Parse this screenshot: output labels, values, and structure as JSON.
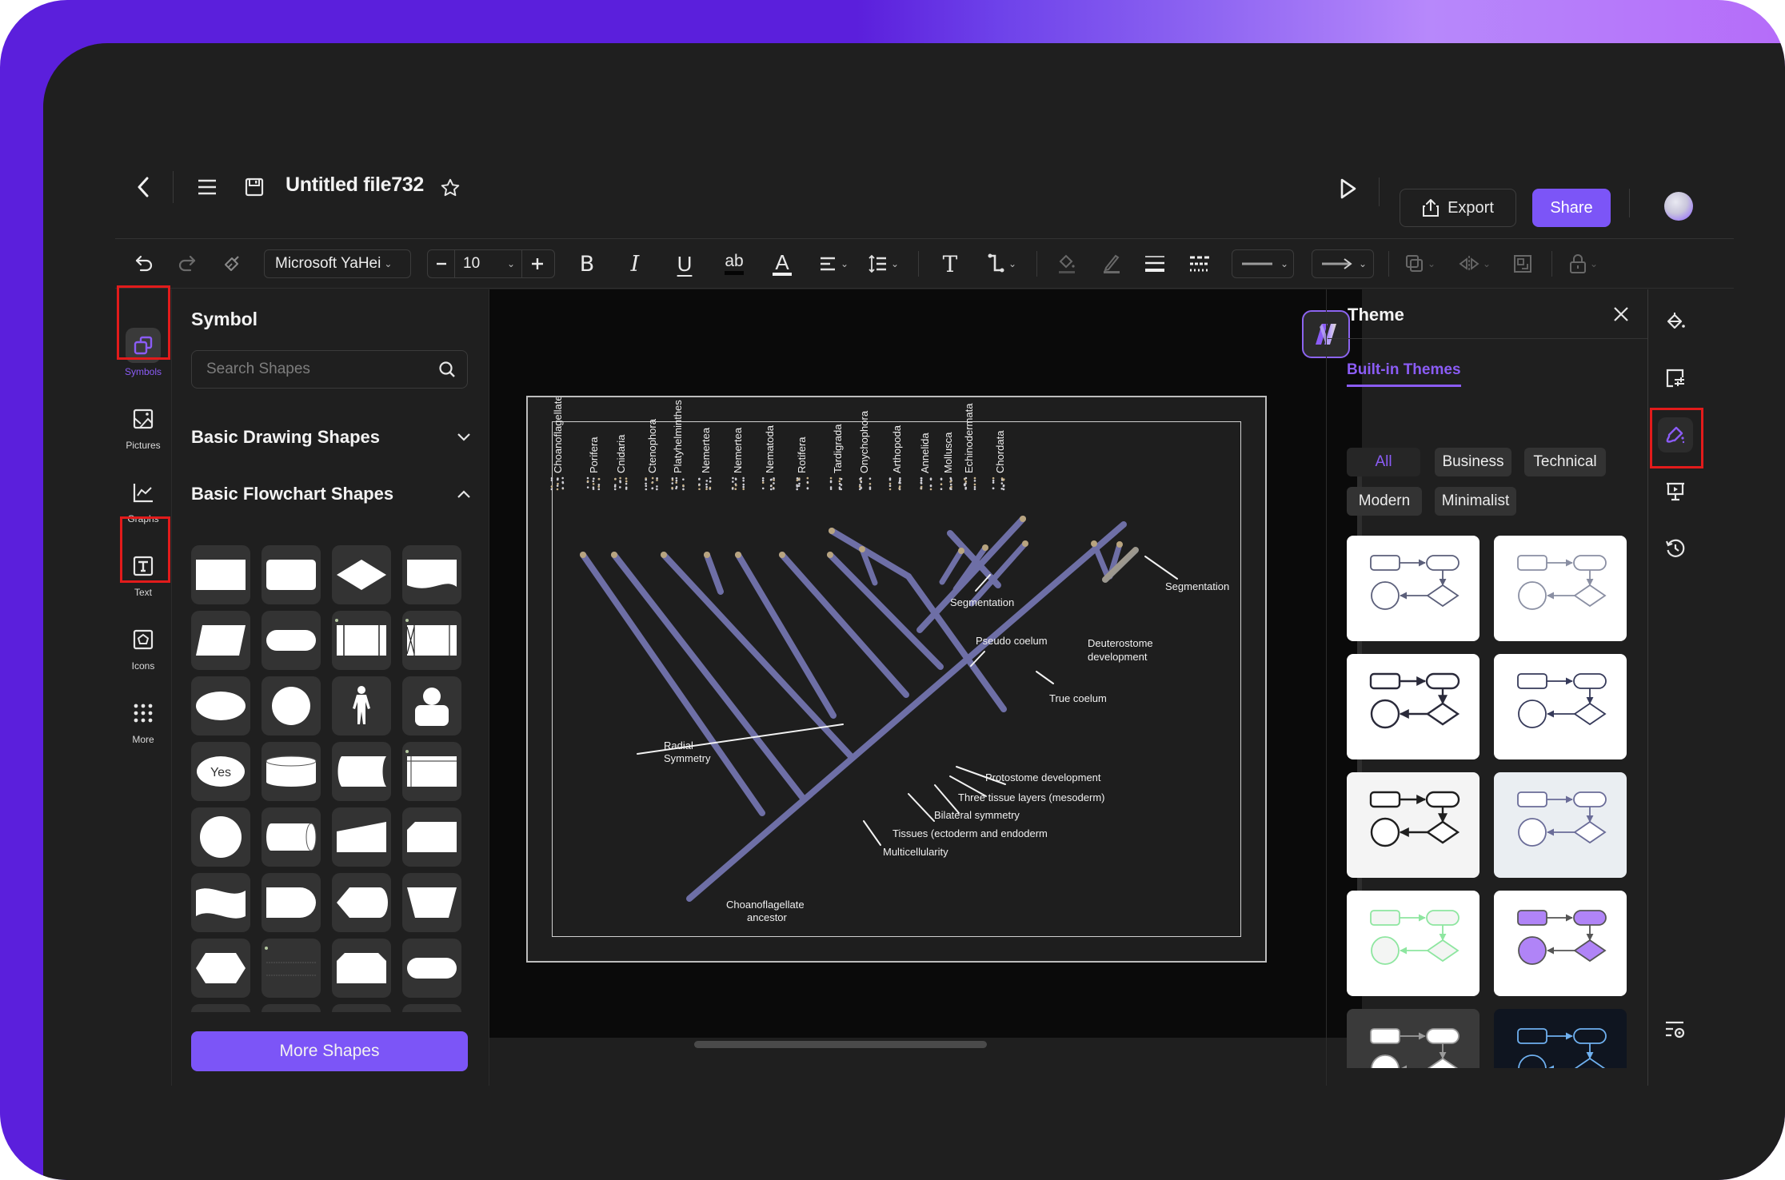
{
  "header": {
    "back_icon": "chevron-left-icon",
    "menu_icon": "hamburger-menu-icon",
    "save_icon": "floppy-save-icon",
    "file_title": "Untitled file732",
    "favorite_icon": "star-icon",
    "play_icon": "play-icon",
    "export_label": "Export",
    "export_icon": "export-share-icon",
    "share_label": "Share",
    "avatar": "user-avatar"
  },
  "toolbar": {
    "undo": "undo-icon",
    "redo": "redo-icon",
    "format_painter": "format-painter-icon",
    "font_family": "Microsoft YaHei",
    "font_size": "10",
    "decrease": "minus-icon",
    "increase": "plus-icon",
    "bold": "B",
    "italic": "I",
    "underline": "U",
    "text_highlight": "ab",
    "font_color": "A",
    "align": "align-icon",
    "line_spacing": "line-spacing-icon",
    "text_tool": "T",
    "connector": "connector-icon",
    "fill": "fill-bucket-icon",
    "line_color": "pen-icon",
    "line_weight": "line-weight-icon",
    "dash_style": "dash-style-icon",
    "line_style_select": "line-style",
    "arrow_style_select": "arrow-style",
    "arrange": "arrange-icon",
    "flip": "flip-icon",
    "group": "group-icon",
    "lock": "lock-icon"
  },
  "left_rail": {
    "items": [
      {
        "label": "Symbols",
        "icon": "symbols-icon",
        "active": true
      },
      {
        "label": "Pictures",
        "icon": "picture-icon",
        "active": false
      },
      {
        "label": "Graphs",
        "icon": "graph-icon",
        "active": false
      },
      {
        "label": "Text",
        "icon": "text-box-icon",
        "active": false
      },
      {
        "label": "Icons",
        "icon": "icons-icon",
        "active": false
      },
      {
        "label": "More",
        "icon": "grid-dots-icon",
        "active": false
      }
    ]
  },
  "symbol_panel": {
    "title": "Symbol",
    "search_placeholder": "Search Shapes",
    "sections": [
      {
        "title": "Basic Drawing Shapes",
        "expanded": false
      },
      {
        "title": "Basic Flowchart Shapes",
        "expanded": true
      }
    ],
    "shapes": [
      "process",
      "rounded-rectangle",
      "decision",
      "document",
      "data-parallelogram",
      "terminator",
      "predefined-process",
      "stored-data-frame",
      "ellipse",
      "circle",
      "actor",
      "user",
      "yes-decision",
      "database-cylinder",
      "stored-data",
      "internal-storage",
      "connector-circle",
      "direct-access-storage",
      "manual-input",
      "card",
      "punched-tape",
      "delay",
      "display",
      "manual-operation",
      "preparation-hexagon",
      "note-lines",
      "loop-limit",
      "terminator-rounded"
    ],
    "yes_text": "Yes",
    "more_shapes_label": "More Shapes"
  },
  "canvas": {
    "ai_badge": "ai-assistant-icon",
    "diagram": {
      "taxa": [
        "Choanoflagellate s",
        "Porifera",
        "Cnidaria",
        "Ctenophora",
        "Platyhelminthes",
        "Nemertea",
        "Nemertea",
        "Nematoda",
        "Rotifera",
        "Tardigrada",
        "Onychophora",
        "Arthopoda",
        "Annelida",
        "Mollusca",
        "Echinodermata",
        "Chordata"
      ],
      "annotations": {
        "segmentation_left": "Segmentation",
        "segmentation_right": "Segmentation",
        "pseudo_coelum": "Pseudo coelum",
        "deuterostome_1": "Deuterostome",
        "deuterostome_2": "development",
        "true_coelum": "True coelum",
        "radial_1": "Radial",
        "radial_2": "Symmetry",
        "protostome": "Protostome development",
        "three_tissue": "Three tissue layers (mesoderm)",
        "bilateral": "Bilateral symmetry",
        "tissues": "Tissues (ectoderm and endoderm",
        "multicellularity": "Multicellularity",
        "ancestor_1": "Choanoflagellate",
        "ancestor_2": "ancestor"
      },
      "branch_color": "#6e6fa6"
    }
  },
  "theme_panel": {
    "title": "Theme",
    "close_icon": "close-icon",
    "tab_label": "Built-in Themes",
    "filters": [
      "All",
      "Business",
      "Technical",
      "Modern",
      "Minimalist"
    ],
    "active_filter": "All",
    "themes": [
      {
        "name": "theme-1",
        "bg": "#ffffff",
        "stroke": "#5b5f7a",
        "fill": "#ffffff"
      },
      {
        "name": "theme-2",
        "bg": "#ffffff",
        "stroke": "#8a8fa3",
        "fill": "#ffffff"
      },
      {
        "name": "theme-3",
        "bg": "#ffffff",
        "stroke": "#2a2a3a",
        "fill": "#ffffff"
      },
      {
        "name": "theme-4",
        "bg": "#ffffff",
        "stroke": "#363a5a",
        "fill": "#ffffff"
      },
      {
        "name": "theme-5",
        "bg": "#f4f4f4",
        "stroke": "#1f1f1f",
        "fill": "#ffffff"
      },
      {
        "name": "theme-6",
        "bg": "#eaeef2",
        "stroke": "#6a6c98",
        "fill": "#ffffff"
      },
      {
        "name": "theme-7",
        "bg": "#ffffff",
        "stroke": "#8ee6a0",
        "fill": "#f3f5f3"
      },
      {
        "name": "theme-8",
        "bg": "#ffffff",
        "stroke": "#555555",
        "fill": "#b084f7"
      },
      {
        "name": "theme-9",
        "bg": "#3a3a3a",
        "stroke": "#9a9a9a",
        "fill": "#ffffff"
      },
      {
        "name": "theme-10",
        "bg": "#0f1520",
        "stroke": "#6fb0ef",
        "fill": "#0f1520"
      }
    ]
  },
  "right_rail": {
    "items": [
      {
        "icon": "fill-style-icon",
        "active": false
      },
      {
        "icon": "page-setup-icon",
        "active": false
      },
      {
        "icon": "theme-brush-icon",
        "active": true
      },
      {
        "icon": "presentation-icon",
        "active": false
      },
      {
        "icon": "history-icon",
        "active": false
      }
    ],
    "bottom_icon": "settings-list-icon"
  },
  "colors": {
    "accent": "#7c55f7",
    "accent_text": "#8b5cf6",
    "highlight_box": "#e21b1b",
    "frame_gradient_start": "#5b1fdc",
    "frame_gradient_end": "#b56cf9"
  }
}
